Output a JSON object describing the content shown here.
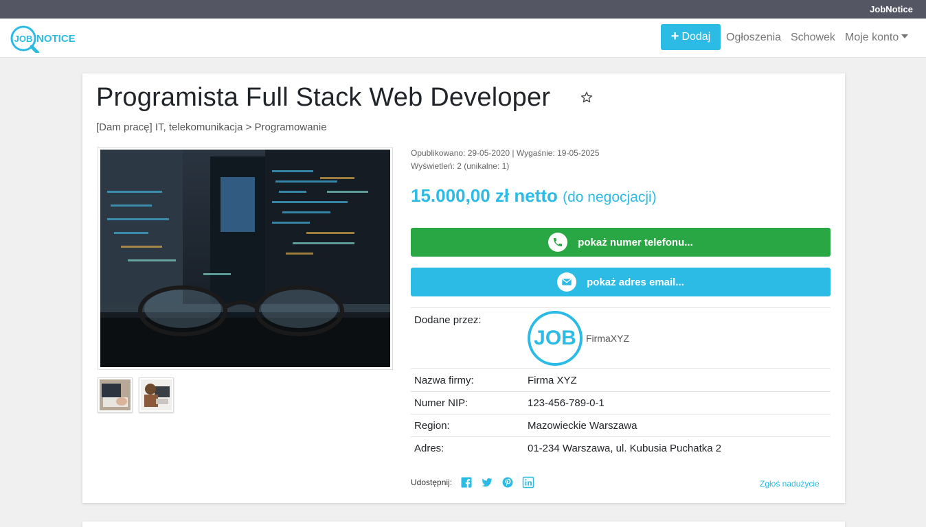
{
  "topbar": {
    "brand": "JobNotice"
  },
  "navbar": {
    "logo_text_job": "JOB",
    "logo_text_notice": "NOTICE",
    "add_label": "Dodaj",
    "links": {
      "ads": "Ogłoszenia",
      "clipboard": "Schowek",
      "account": "Moje konto"
    },
    "accent_color": "#2bbbe4"
  },
  "listing": {
    "title": "Programista Full Stack Web Developer",
    "breadcrumb": "[Dam pracę] IT, telekomunikacja > Programowanie",
    "published": "Opublikowano: 29-05-2020 | Wygaśnie: 19-05-2025",
    "views": "Wyświetleń: 2 (unikalne: 1)",
    "price": "15.000,00 zł netto",
    "price_note": "(do negocjacji)",
    "phone_button": "pokaż numer telefonu...",
    "email_button": "pokaż adres email...",
    "details": {
      "added_by_label": "Dodane przez:",
      "company_logo_text": "JOB",
      "company_user": "FirmaXYZ",
      "company_name_label": "Nazwa firmy:",
      "company_name": "Firma XYZ",
      "nip_label": "Numer NIP:",
      "nip": "123-456-789-0-1",
      "region_label": "Region:",
      "region": "Mazowieckie Warszawa",
      "address_label": "Adres:",
      "address": "01-234 Warszawa, ul. Kubusia Puchatka 2"
    },
    "share_label": "Udostępnij:",
    "share_icons": [
      "facebook-icon",
      "twitter-icon",
      "pinterest-icon",
      "linkedin-icon"
    ],
    "report_link": "Zgłoś nadużycie",
    "phone_button_color": "#29a744",
    "email_button_color": "#2bbbe4"
  }
}
